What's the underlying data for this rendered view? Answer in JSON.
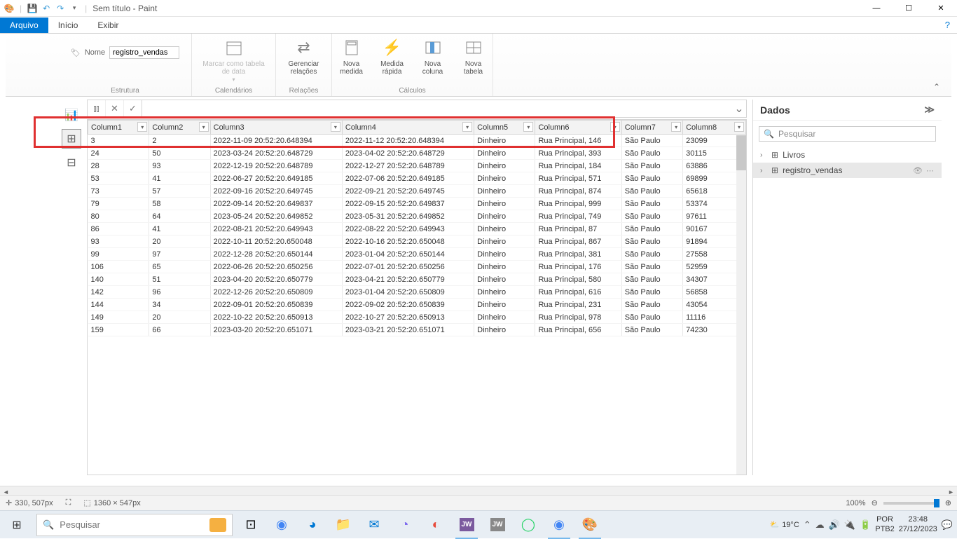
{
  "titlebar": {
    "title": "Sem título - Paint"
  },
  "menubar": {
    "tabs": [
      "Arquivo",
      "Início",
      "Exibir"
    ]
  },
  "ribbon": {
    "nome_label": "Nome",
    "nome_value": "registro_vendas",
    "estrutura": "Estrutura",
    "marcar": "Marcar como tabela de data",
    "calendarios": "Calendários",
    "gerenciar": "Gerenciar relações",
    "relacoes": "Relações",
    "nova_medida": "Nova medida",
    "medida_rapida": "Medida rápida",
    "nova_coluna": "Nova coluna",
    "nova_tabela": "Nova tabela",
    "calculos": "Cálculos"
  },
  "dados": {
    "title": "Dados",
    "search_placeholder": "Pesquisar",
    "items": [
      {
        "label": "Livros",
        "selected": false
      },
      {
        "label": "registro_vendas",
        "selected": true
      }
    ]
  },
  "columns": [
    "Column1",
    "Column2",
    "Column3",
    "Column4",
    "Column5",
    "Column6",
    "Column7",
    "Column8"
  ],
  "rows": [
    [
      "3",
      "2",
      "2022-11-09 20:52:20.648394",
      "2022-11-12 20:52:20.648394",
      "Dinheiro",
      "Rua Principal, 146",
      "São Paulo",
      "23099"
    ],
    [
      "24",
      "50",
      "2023-03-24 20:52:20.648729",
      "2023-04-02 20:52:20.648729",
      "Dinheiro",
      "Rua Principal, 393",
      "São Paulo",
      "30115"
    ],
    [
      "28",
      "93",
      "2022-12-19 20:52:20.648789",
      "2022-12-27 20:52:20.648789",
      "Dinheiro",
      "Rua Principal, 184",
      "São Paulo",
      "63886"
    ],
    [
      "53",
      "41",
      "2022-06-27 20:52:20.649185",
      "2022-07-06 20:52:20.649185",
      "Dinheiro",
      "Rua Principal, 571",
      "São Paulo",
      "69899"
    ],
    [
      "73",
      "57",
      "2022-09-16 20:52:20.649745",
      "2022-09-21 20:52:20.649745",
      "Dinheiro",
      "Rua Principal, 874",
      "São Paulo",
      "65618"
    ],
    [
      "79",
      "58",
      "2022-09-14 20:52:20.649837",
      "2022-09-15 20:52:20.649837",
      "Dinheiro",
      "Rua Principal, 999",
      "São Paulo",
      "53374"
    ],
    [
      "80",
      "64",
      "2023-05-24 20:52:20.649852",
      "2023-05-31 20:52:20.649852",
      "Dinheiro",
      "Rua Principal, 749",
      "São Paulo",
      "97611"
    ],
    [
      "86",
      "41",
      "2022-08-21 20:52:20.649943",
      "2022-08-22 20:52:20.649943",
      "Dinheiro",
      "Rua Principal, 87",
      "São Paulo",
      "90167"
    ],
    [
      "93",
      "20",
      "2022-10-11 20:52:20.650048",
      "2022-10-16 20:52:20.650048",
      "Dinheiro",
      "Rua Principal, 867",
      "São Paulo",
      "91894"
    ],
    [
      "99",
      "97",
      "2022-12-28 20:52:20.650144",
      "2023-01-04 20:52:20.650144",
      "Dinheiro",
      "Rua Principal, 381",
      "São Paulo",
      "27558"
    ],
    [
      "106",
      "65",
      "2022-06-26 20:52:20.650256",
      "2022-07-01 20:52:20.650256",
      "Dinheiro",
      "Rua Principal, 176",
      "São Paulo",
      "52959"
    ],
    [
      "140",
      "51",
      "2023-04-20 20:52:20.650779",
      "2023-04-21 20:52:20.650779",
      "Dinheiro",
      "Rua Principal, 580",
      "São Paulo",
      "34307"
    ],
    [
      "142",
      "96",
      "2022-12-26 20:52:20.650809",
      "2023-01-04 20:52:20.650809",
      "Dinheiro",
      "Rua Principal, 616",
      "São Paulo",
      "56858"
    ],
    [
      "144",
      "34",
      "2022-09-01 20:52:20.650839",
      "2022-09-02 20:52:20.650839",
      "Dinheiro",
      "Rua Principal, 231",
      "São Paulo",
      "43054"
    ],
    [
      "149",
      "20",
      "2022-10-22 20:52:20.650913",
      "2022-10-27 20:52:20.650913",
      "Dinheiro",
      "Rua Principal, 978",
      "São Paulo",
      "11116"
    ],
    [
      "159",
      "66",
      "2023-03-20 20:52:20.651071",
      "2023-03-21 20:52:20.651071",
      "Dinheiro",
      "Rua Principal, 656",
      "São Paulo",
      "74230"
    ]
  ],
  "statusbar": {
    "coords": "330, 507px",
    "canvas": "1360 × 547px",
    "zoom": "100%"
  },
  "taskbar": {
    "search_placeholder": "Pesquisar",
    "weather": "19°C",
    "lang1": "POR",
    "lang2": "PTB2",
    "time": "23:48",
    "date": "27/12/2023"
  }
}
